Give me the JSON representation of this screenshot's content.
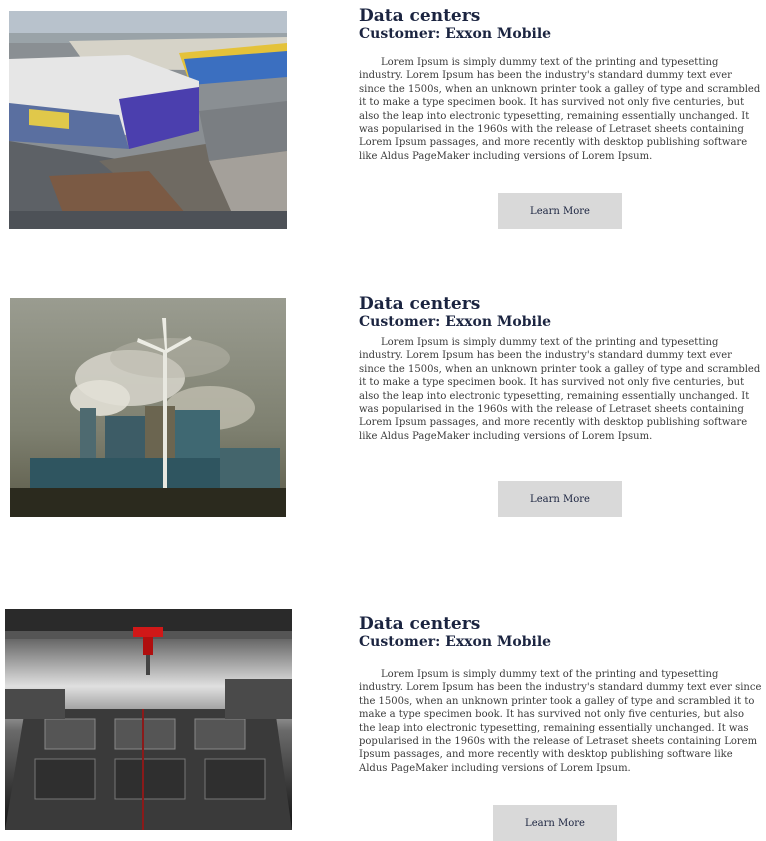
{
  "cards": [
    {
      "title": "Data centers",
      "customer": "Customer: Exxon Mobile",
      "body": "Lorem Ipsum is simply dummy text of the printing and typesetting industry. Lorem Ipsum has been the industry's standard dummy text ever since the 1500s, when an unknown printer took a galley of type and scrambled it to make a type specimen book. It has survived not only five centuries, but also the leap into electronic typesetting, remaining essentially unchanged. It was popularised in the 1960s with the release of Letraset sheets containing Lorem Ipsum passages, and more recently with desktop publishing software like Aldus PageMaker including versions of Lorem Ipsum.",
      "button_label": "Learn More"
    },
    {
      "title": "Data centers",
      "customer": "Customer: Exxon Mobile",
      "body": "Lorem Ipsum is simply dummy text of the printing and typesetting industry. Lorem Ipsum has been the industry's standard dummy text ever since the 1500s, when an unknown printer took a galley of type and scrambled it to make a type specimen book. It has survived not only five centuries, but also the leap into electronic typesetting, remaining essentially unchanged. It was popularised in the 1960s with the release of Letraset sheets containing Lorem Ipsum passages, and more recently with desktop publishing software like Aldus PageMaker including versions of Lorem Ipsum.",
      "button_label": "Learn More"
    },
    {
      "title": "Data centers",
      "customer": "Customer: Exxon Mobile",
      "body": "Lorem Ipsum is simply dummy text of the printing and typesetting industry. Lorem Ipsum has been the industry's standard dummy text ever since the 1500s, when an unknown printer took a galley of type and scrambled it to make a type specimen book. It has survived not only five centuries, but also the leap into electronic typesetting, remaining essentially unchanged. It was popularised in the 1960s with the release of Letraset sheets containing Lorem Ipsum passages, and more recently with desktop publishing software like Aldus PageMaker including versions of Lorem Ipsum.",
      "button_label": "Learn More"
    }
  ]
}
